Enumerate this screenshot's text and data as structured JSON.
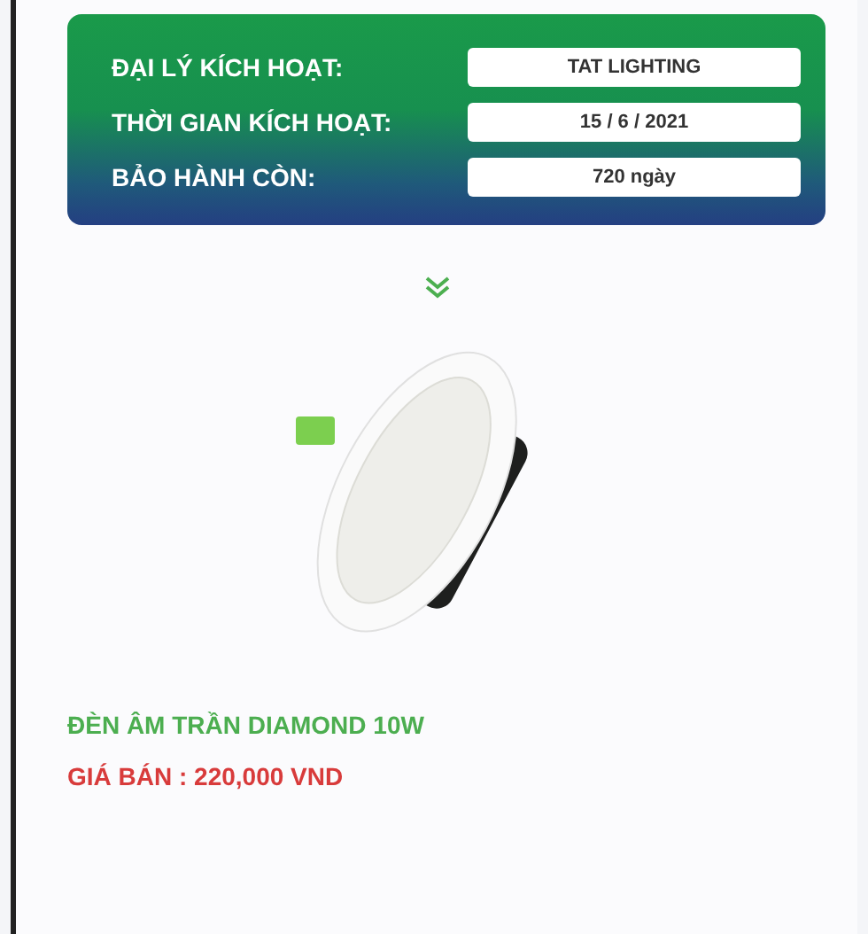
{
  "activation": {
    "rows": [
      {
        "label": "ĐẠI LÝ KÍCH HOẠT:",
        "value": "TAT LIGHTING"
      },
      {
        "label": "THỜI GIAN KÍCH HOẠT:",
        "value": "15 / 6 / 2021"
      },
      {
        "label": "BẢO HÀNH CÒN:",
        "value": "720 ngày"
      }
    ]
  },
  "product": {
    "name": "ĐÈN ÂM TRẦN DIAMOND 10W",
    "price": "GIÁ BÁN : 220,000 VND"
  }
}
